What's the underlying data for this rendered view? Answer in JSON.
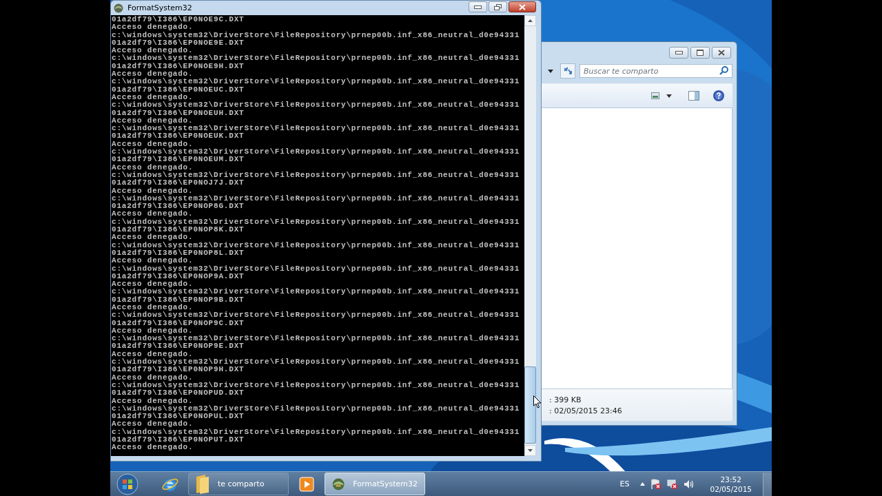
{
  "console_window": {
    "title": "FormatSystem32",
    "lines": [
      "01a2df79\\I386\\EP0NOE9C.DXT",
      "Acceso denegado.",
      "c:\\windows\\system32\\DriverStore\\FileRepository\\prnep00b.inf_x86_neutral_d0e94331",
      "01a2df79\\I386\\EP0NOE9E.DXT",
      "Acceso denegado.",
      "c:\\windows\\system32\\DriverStore\\FileRepository\\prnep00b.inf_x86_neutral_d0e94331",
      "01a2df79\\I386\\EP0NOE9H.DXT",
      "Acceso denegado.",
      "c:\\windows\\system32\\DriverStore\\FileRepository\\prnep00b.inf_x86_neutral_d0e94331",
      "01a2df79\\I386\\EP0NOEUC.DXT",
      "Acceso denegado.",
      "c:\\windows\\system32\\DriverStore\\FileRepository\\prnep00b.inf_x86_neutral_d0e94331",
      "01a2df79\\I386\\EP0NOEUH.DXT",
      "Acceso denegado.",
      "c:\\windows\\system32\\DriverStore\\FileRepository\\prnep00b.inf_x86_neutral_d0e94331",
      "01a2df79\\I386\\EP0NOEUK.DXT",
      "Acceso denegado.",
      "c:\\windows\\system32\\DriverStore\\FileRepository\\prnep00b.inf_x86_neutral_d0e94331",
      "01a2df79\\I386\\EP0NOEUM.DXT",
      "Acceso denegado.",
      "c:\\windows\\system32\\DriverStore\\FileRepository\\prnep00b.inf_x86_neutral_d0e94331",
      "01a2df79\\I386\\EP0NOJ7J.DXT",
      "Acceso denegado.",
      "c:\\windows\\system32\\DriverStore\\FileRepository\\prnep00b.inf_x86_neutral_d0e94331",
      "01a2df79\\I386\\EP0NOP8G.DXT",
      "Acceso denegado.",
      "c:\\windows\\system32\\DriverStore\\FileRepository\\prnep00b.inf_x86_neutral_d0e94331",
      "01a2df79\\I386\\EP0NOP8K.DXT",
      "Acceso denegado.",
      "c:\\windows\\system32\\DriverStore\\FileRepository\\prnep00b.inf_x86_neutral_d0e94331",
      "01a2df79\\I386\\EP0NOP8L.DXT",
      "Acceso denegado.",
      "c:\\windows\\system32\\DriverStore\\FileRepository\\prnep00b.inf_x86_neutral_d0e94331",
      "01a2df79\\I386\\EP0NOP9A.DXT",
      "Acceso denegado.",
      "c:\\windows\\system32\\DriverStore\\FileRepository\\prnep00b.inf_x86_neutral_d0e94331",
      "01a2df79\\I386\\EP0NOP9B.DXT",
      "Acceso denegado.",
      "c:\\windows\\system32\\DriverStore\\FileRepository\\prnep00b.inf_x86_neutral_d0e94331",
      "01a2df79\\I386\\EP0NOP9C.DXT",
      "Acceso denegado.",
      "c:\\windows\\system32\\DriverStore\\FileRepository\\prnep00b.inf_x86_neutral_d0e94331",
      "01a2df79\\I386\\EP0NOP9E.DXT",
      "Acceso denegado.",
      "c:\\windows\\system32\\DriverStore\\FileRepository\\prnep00b.inf_x86_neutral_d0e94331",
      "01a2df79\\I386\\EP0NOP9H.DXT",
      "Acceso denegado.",
      "c:\\windows\\system32\\DriverStore\\FileRepository\\prnep00b.inf_x86_neutral_d0e94331",
      "01a2df79\\I386\\EP0NOPUD.DXT",
      "Acceso denegado.",
      "c:\\windows\\system32\\DriverStore\\FileRepository\\prnep00b.inf_x86_neutral_d0e94331",
      "01a2df79\\I386\\EP0NOPUL.DXT",
      "Acceso denegado.",
      "c:\\windows\\system32\\DriverStore\\FileRepository\\prnep00b.inf_x86_neutral_d0e94331",
      "01a2df79\\I386\\EP0NOPUT.DXT",
      "Acceso denegado."
    ]
  },
  "explorer_window": {
    "search": {
      "placeholder": "Buscar te comparto"
    },
    "details": [
      ": 399 KB",
      ": 02/05/2015 23:46"
    ]
  },
  "taskbar": {
    "items": [
      {
        "kind": "browser",
        "selected": false
      },
      {
        "kind": "folder",
        "label": "te comparto",
        "selected": false
      },
      {
        "kind": "media",
        "selected": false
      },
      {
        "kind": "console",
        "label": "FormatSystem32",
        "selected": true
      }
    ],
    "language": "ES",
    "time": "23:52",
    "date": "02/05/2015"
  }
}
